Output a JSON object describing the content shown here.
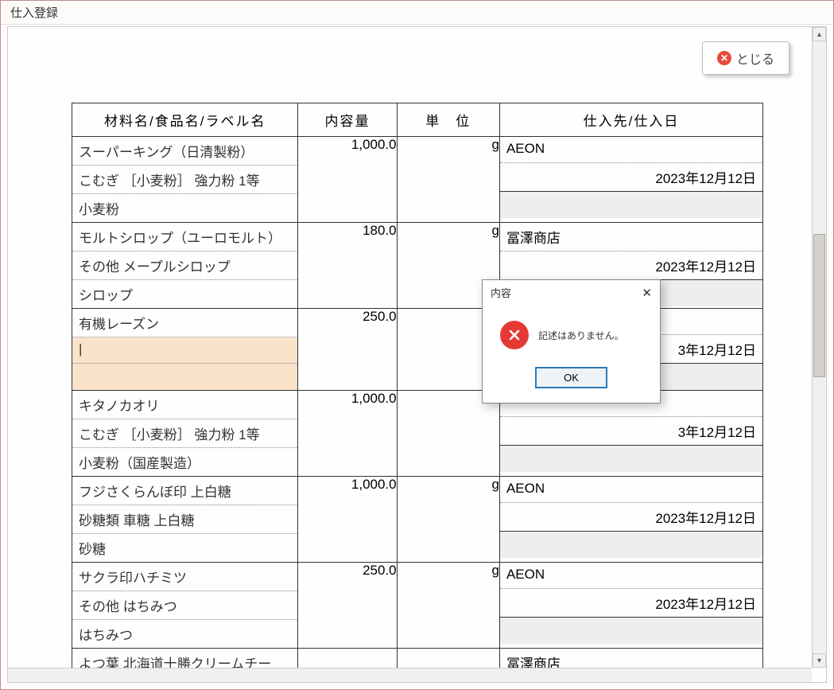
{
  "window": {
    "title": "仕入登録"
  },
  "toolbar": {
    "close_label": "とじる"
  },
  "table": {
    "headers": {
      "name": "材料名/食品名/ラベル名",
      "amount": "内容量",
      "unit": "単　位",
      "supplier": "仕入先/仕入日"
    },
    "rows": [
      {
        "name1": "スーパーキング（日清製粉）",
        "name2": "こむぎ ［小麦粉］ 強力粉  1等",
        "name3": "小麦粉",
        "amount": "1,000.0",
        "unit": "g",
        "supplier": "AEON",
        "date": "2023年12月12日",
        "hl": false
      },
      {
        "name1": "モルトシロップ（ユーロモルト）",
        "name2": "その他  メープルシロップ",
        "name3": "シロップ",
        "amount": "180.0",
        "unit": "g",
        "supplier": "冨澤商店",
        "date": "2023年12月12日",
        "hl": false
      },
      {
        "name1": "有機レーズン",
        "name2": "|",
        "name3": "",
        "amount": "250.0",
        "unit": "",
        "supplier": "",
        "date": "3年12月12日",
        "hl": true
      },
      {
        "name1": "キタノカオリ",
        "name2": "こむぎ ［小麦粉］ 強力粉  1等",
        "name3": "小麦粉（国産製造）",
        "amount": "1,000.0",
        "unit": "",
        "supplier": "",
        "date": "3年12月12日",
        "hl": false
      },
      {
        "name1": "フジさくらんぼ印 上白糖",
        "name2": "砂糖類  車糖  上白糖",
        "name3": "砂糖",
        "amount": "1,000.0",
        "unit": "g",
        "supplier": "AEON",
        "date": "2023年12月12日",
        "hl": false
      },
      {
        "name1": "サクラ印ハチミツ",
        "name2": "その他  はちみつ",
        "name3": "はちみつ",
        "amount": "250.0",
        "unit": "g",
        "supplier": "AEON",
        "date": "2023年12月12日",
        "hl": false
      }
    ],
    "partial_row": {
      "name1": "よつ葉 北海道十勝クリームチー",
      "supplier": "冨澤商店"
    }
  },
  "dialog": {
    "title": "内容",
    "message": "記述はありません。",
    "ok_label": "OK"
  }
}
